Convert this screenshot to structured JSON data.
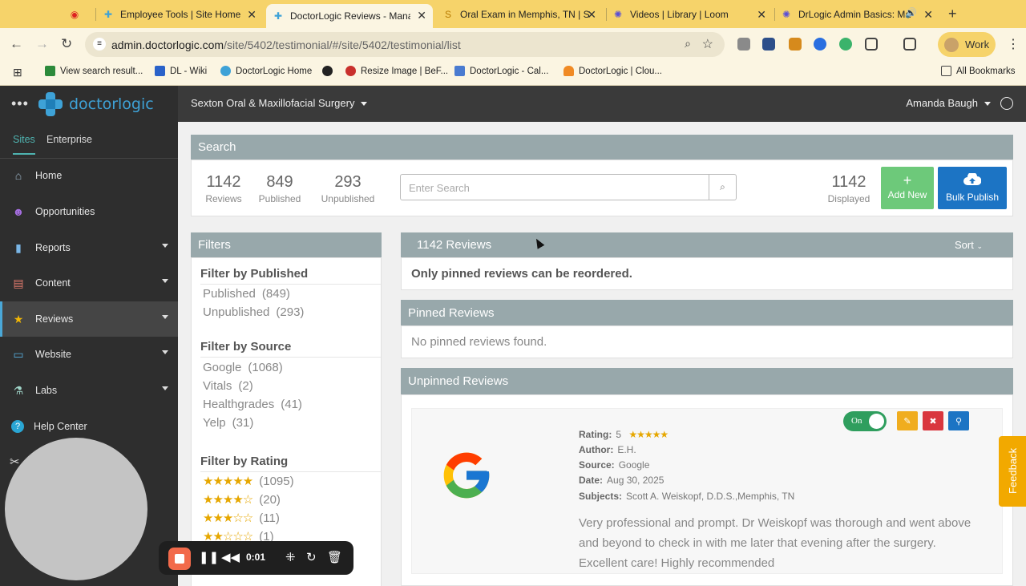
{
  "browser": {
    "tabs": [
      {
        "title": "",
        "icon": "record-icon"
      },
      {
        "title": "Employee Tools | Site Home",
        "icon": "doctorlogic-icon"
      },
      {
        "title": "DoctorLogic Reviews - Manag",
        "icon": "doctorlogic-icon"
      },
      {
        "title": "Oral Exam in Memphis, TN | S",
        "icon": "dollar-icon"
      },
      {
        "title": "Videos | Library | Loom",
        "icon": "loom-icon"
      },
      {
        "title": "DrLogic Admin Basics: Ma",
        "icon": "loom-icon"
      }
    ],
    "url_host": "admin.doctorlogic.com",
    "url_path": "/site/5402/testimonial/#/site/5402/testimonial/list",
    "profile_label": "Work",
    "bookmarks": [
      "View search result...",
      "DL - Wiki",
      "DoctorLogic Home",
      "",
      "Resize Image | BeF...",
      "DoctorLogic - Cal...",
      "DoctorLogic | Clou..."
    ],
    "all_bookmarks": "All Bookmarks"
  },
  "brand": {
    "name": "doctorlogic",
    "accent": "#3ea2d7"
  },
  "sidebar": {
    "tabs": [
      "Sites",
      "Enterprise"
    ],
    "items": [
      {
        "label": "Home",
        "icon": "home-icon"
      },
      {
        "label": "Opportunities",
        "icon": "people-icon"
      },
      {
        "label": "Reports",
        "icon": "chart-icon"
      },
      {
        "label": "Content",
        "icon": "document-icon"
      },
      {
        "label": "Reviews",
        "icon": "star-icon"
      },
      {
        "label": "Website",
        "icon": "browser-icon"
      },
      {
        "label": "Labs",
        "icon": "flask-icon"
      },
      {
        "label": "Help Center",
        "icon": "help-icon"
      }
    ]
  },
  "header": {
    "practice": "Sexton Oral & Maxillofacial Surgery",
    "user": "Amanda Baugh"
  },
  "search_panel": {
    "title": "Search",
    "stats": [
      {
        "value": "1142",
        "label": "Reviews"
      },
      {
        "value": "849",
        "label": "Published"
      },
      {
        "value": "293",
        "label": "Unpublished"
      }
    ],
    "placeholder": "Enter Search",
    "displayed_value": "1142",
    "displayed_label": "Displayed",
    "add_new": "Add New",
    "bulk_publish": "Bulk Publish"
  },
  "filters": {
    "title": "Filters",
    "by_published": {
      "title": "Filter by Published",
      "items": [
        {
          "label": "Published",
          "count": "(849)"
        },
        {
          "label": "Unpublished",
          "count": "(293)"
        }
      ]
    },
    "by_source": {
      "title": "Filter by Source",
      "items": [
        {
          "label": "Google",
          "count": "(1068)"
        },
        {
          "label": "Vitals",
          "count": "(2)"
        },
        {
          "label": "Healthgrades",
          "count": "(41)"
        },
        {
          "label": "Yelp",
          "count": "(31)"
        }
      ]
    },
    "by_rating": {
      "title": "Filter by Rating",
      "items": [
        {
          "stars": 5,
          "count": "(1095)"
        },
        {
          "stars": 4,
          "count": "(20)"
        },
        {
          "stars": 3,
          "count": "(11)"
        },
        {
          "stars": 2,
          "count": "(1)"
        }
      ]
    }
  },
  "reviews_panel": {
    "title": "1142 Reviews",
    "sort": "Sort",
    "notice": "Only pinned reviews can be reordered.",
    "pinned_title": "Pinned Reviews",
    "pinned_empty": "No pinned reviews found.",
    "unpinned_title": "Unpinned Reviews"
  },
  "review": {
    "toggle": "On",
    "rating_label": "Rating:",
    "rating": "5",
    "author_label": "Author:",
    "author": "E.H.",
    "source_label": "Source:",
    "source": "Google",
    "date_label": "Date:",
    "date": "Aug 30, 2025",
    "subjects_label": "Subjects:",
    "subjects": "Scott A. Weiskopf, D.D.S.,Memphis, TN",
    "text": "Very professional and prompt. Dr Weiskopf was thorough and went above and beyond to check in with me later that evening after the surgery. Excellent care! Highly recommended"
  },
  "feedback": "Feedback",
  "recorder": {
    "time": "0:01"
  },
  "colors": {
    "header_panel": "#98a8ab",
    "add_new": "#6dc97a",
    "bulk_publish": "#1c74c4",
    "toggle_on": "#2f9e5e",
    "feedback": "#f2a900"
  }
}
